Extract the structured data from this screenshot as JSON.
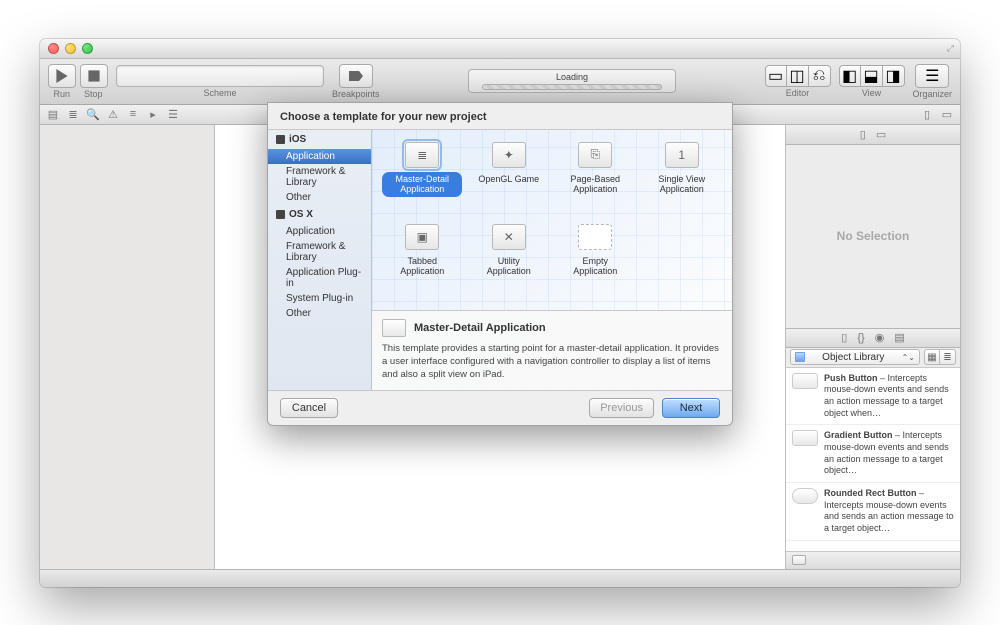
{
  "toolbar": {
    "run_label": "Run",
    "stop_label": "Stop",
    "scheme_label": "Scheme",
    "breakpoints_label": "Breakpoints",
    "loading_label": "Loading",
    "editor_label": "Editor",
    "view_label": "View",
    "organizer_label": "Organizer"
  },
  "right_panel": {
    "no_selection": "No Selection",
    "library_select": "Object Library",
    "items": [
      {
        "name": "Push Button",
        "desc": " – Intercepts mouse-down events and sends an action message to a target object when…"
      },
      {
        "name": "Gradient Button",
        "desc": " – Intercepts mouse-down events and sends an action message to a target object…"
      },
      {
        "name": "Rounded Rect Button",
        "desc": " – Intercepts mouse-down events and sends an action message to a target object…"
      }
    ]
  },
  "sheet": {
    "title": "Choose a template for your new project",
    "sidebar": {
      "ios_header": "iOS",
      "ios_items": [
        "Application",
        "Framework & Library",
        "Other"
      ],
      "osx_header": "OS X",
      "osx_items": [
        "Application",
        "Framework & Library",
        "Application Plug-in",
        "System Plug-in",
        "Other"
      ]
    },
    "templates": [
      {
        "label": "Master-Detail Application",
        "selected": true,
        "icon": "list"
      },
      {
        "label": "OpenGL Game",
        "selected": false,
        "icon": "gl"
      },
      {
        "label": "Page-Based Application",
        "selected": false,
        "icon": "page"
      },
      {
        "label": "Single View Application",
        "selected": false,
        "icon": "single"
      },
      {
        "label": "Tabbed Application",
        "selected": false,
        "icon": "tab"
      },
      {
        "label": "Utility Application",
        "selected": false,
        "icon": "util"
      },
      {
        "label": "Empty Application",
        "selected": false,
        "icon": "empty"
      }
    ],
    "description": {
      "title": "Master-Detail Application",
      "text": "This template provides a starting point for a master-detail application. It provides a user interface configured with a navigation controller to display a list of items and also a split view on iPad."
    },
    "buttons": {
      "cancel": "Cancel",
      "previous": "Previous",
      "next": "Next"
    }
  }
}
